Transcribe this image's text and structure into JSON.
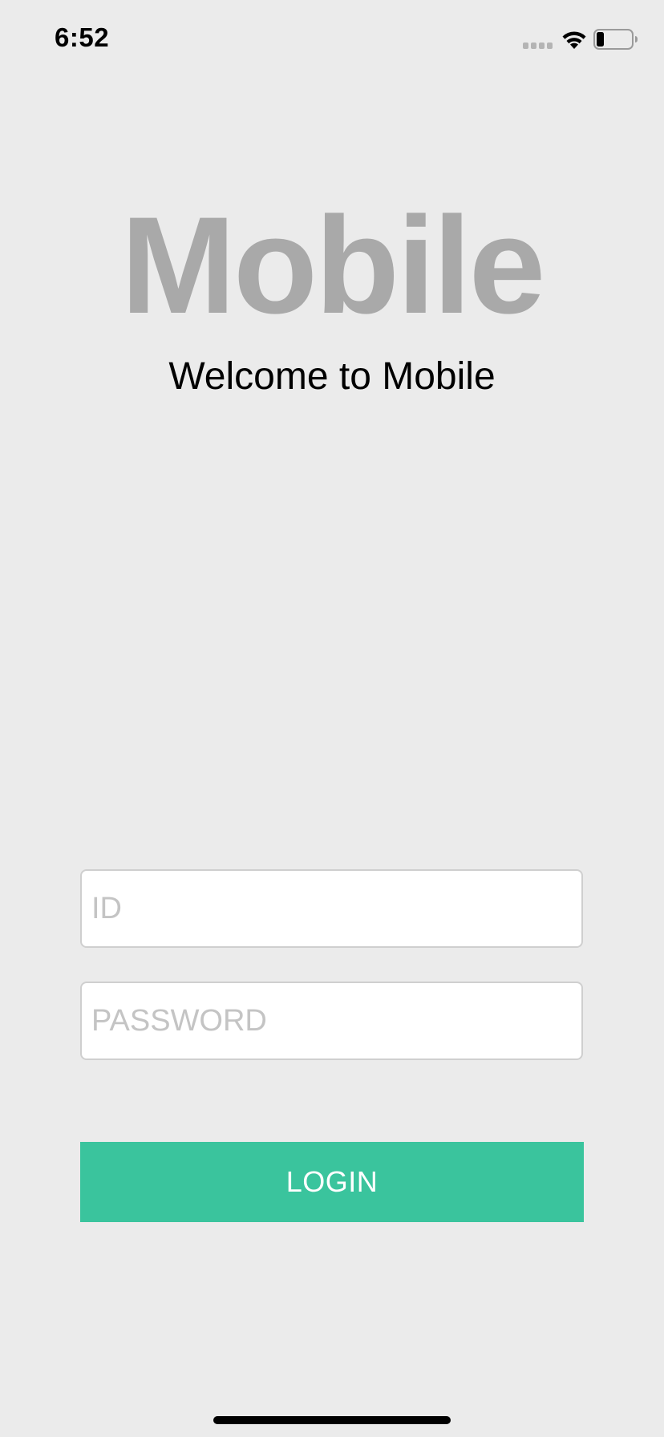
{
  "status_bar": {
    "time": "6:52",
    "signal_icon": "cellular-signal-icon",
    "wifi_icon": "wifi-icon",
    "battery_icon": "battery-icon",
    "battery_level": 0.2
  },
  "header": {
    "app_title": "Mobile",
    "welcome": "Welcome to Mobile"
  },
  "form": {
    "id_placeholder": "ID",
    "id_value": "",
    "password_placeholder": "PASSWORD",
    "password_value": "",
    "login_label": "LOGIN"
  },
  "colors": {
    "background": "#ebebeb",
    "accent": "#3ac49d",
    "title_gray": "#a9a9a9"
  }
}
